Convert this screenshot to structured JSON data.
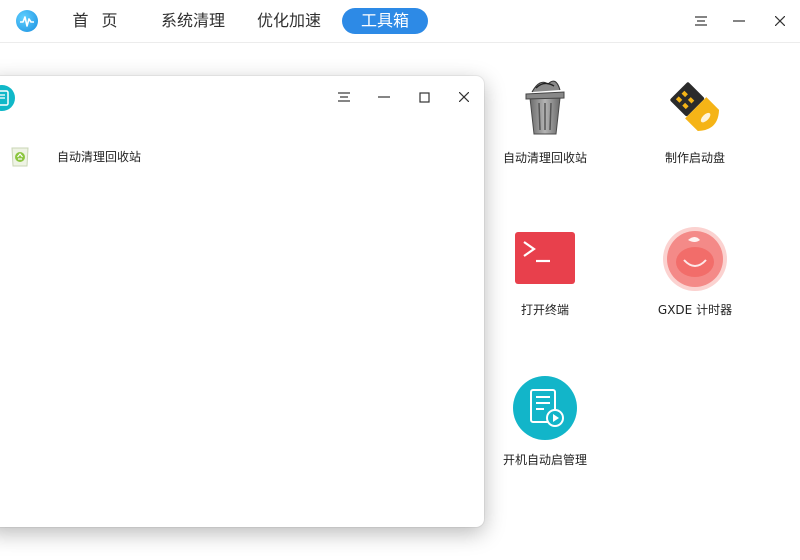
{
  "nav": {
    "tabs": [
      {
        "label": "首 页"
      },
      {
        "label": "系统清理"
      },
      {
        "label": "优化加速"
      },
      {
        "label": "工具箱"
      }
    ],
    "active_tab": "工具箱"
  },
  "tools": [
    {
      "label": "自动清理回收站",
      "icon": "trash-bin-icon"
    },
    {
      "label": "制作启动盘",
      "icon": "usb-drive-icon"
    },
    {
      "label": "打开终端",
      "icon": "terminal-icon"
    },
    {
      "label": "GXDE 计时器",
      "icon": "tomato-timer-icon"
    },
    {
      "label": "开机自动启管理",
      "icon": "startup-manager-icon"
    }
  ],
  "dialog": {
    "items": [
      {
        "label": "自动清理回收站",
        "icon": "recycle-bin-icon"
      }
    ]
  },
  "colors": {
    "accent": "#2d8ae6",
    "terminal": "#e8404c",
    "usb": "#f5b417",
    "timer": "#f48a88",
    "startup": "#12b5c9"
  }
}
